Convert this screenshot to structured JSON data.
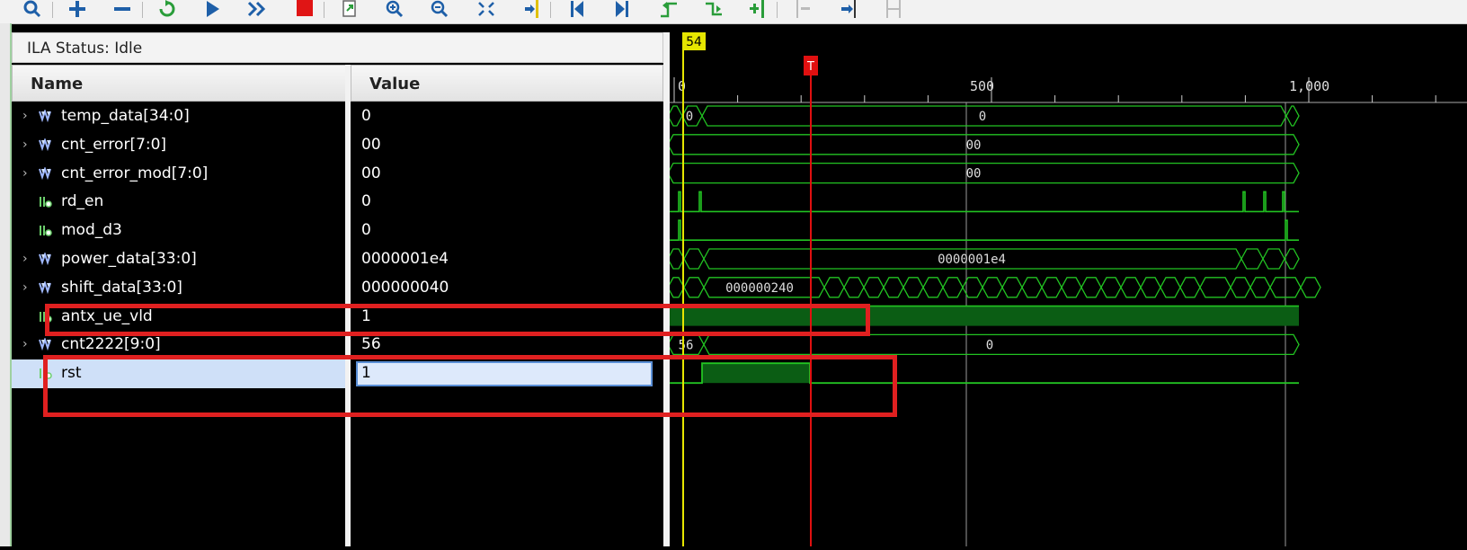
{
  "toolbar": {
    "buttons": [
      "search-icon",
      "plus-icon",
      "minus-icon",
      "refresh-icon",
      "play-icon",
      "fast-forward-icon",
      "stop-icon",
      "export-icon",
      "zoom-in-icon",
      "zoom-out-icon",
      "zoom-fit-icon",
      "go-to-cursor-icon",
      "first-edge-icon",
      "last-edge-icon",
      "prev-transition-icon",
      "next-transition-icon",
      "add-marker-icon",
      "prev-marker-icon",
      "next-marker-icon",
      "swap-cursors-icon"
    ]
  },
  "ila_status": "ILA Status: Idle",
  "headers": {
    "name": "Name",
    "value": "Value"
  },
  "signals": [
    {
      "name": "temp_data[34:0]",
      "value": "0",
      "bus": true
    },
    {
      "name": "cnt_error[7:0]",
      "value": "00",
      "bus": true
    },
    {
      "name": "cnt_error_mod[7:0]",
      "value": "00",
      "bus": true
    },
    {
      "name": "rd_en",
      "value": "0",
      "bus": false
    },
    {
      "name": "mod_d3",
      "value": "0",
      "bus": false
    },
    {
      "name": "power_data[33:0]",
      "value": "0000001e4",
      "bus": true
    },
    {
      "name": "shift_data[33:0]",
      "value": "000000040",
      "bus": true
    },
    {
      "name": "antx_ue_vld",
      "value": "1",
      "bus": false
    },
    {
      "name": "cnt2222[9:0]",
      "value": "56",
      "bus": true
    },
    {
      "name": "rst",
      "value": "1",
      "bus": false,
      "selected": true
    }
  ],
  "waveform": {
    "cursor_label": "54",
    "trigger_label": "T",
    "ruler_ticks": [
      "0",
      "500",
      "1,000"
    ],
    "wave_values": {
      "temp_data": [
        "0",
        "0"
      ],
      "cnt_error": "00",
      "cnt_error_mod": "00",
      "power_data": "0000001e4",
      "shift_data": "000000240",
      "cnt2222": [
        "56",
        "0"
      ]
    },
    "colors": {
      "wave": "#22c322",
      "cursor": "#e6e600",
      "trigger": "#e01010",
      "highlight": "#e02020",
      "fill": "#0b5d14"
    }
  }
}
